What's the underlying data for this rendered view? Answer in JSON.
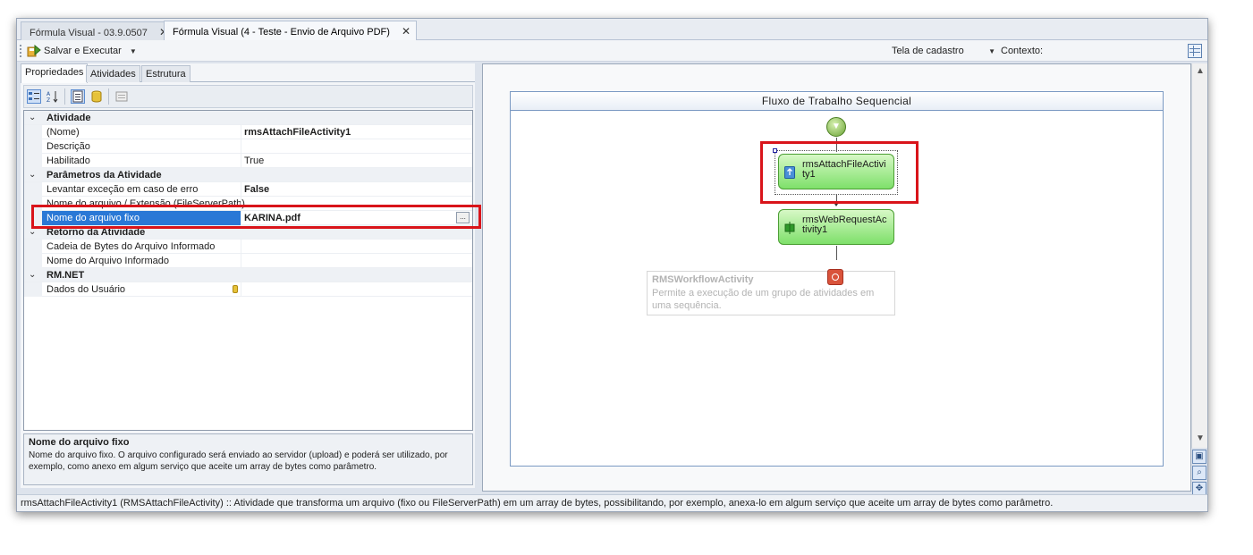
{
  "tabs": [
    {
      "label": "Fórmula Visual - 03.9.0507",
      "close": "✕"
    },
    {
      "label": "Fórmula Visual (4 - Teste - Envio de Arquivo PDF)",
      "close": "✕"
    }
  ],
  "toolbar": {
    "run_label": "Salvar e Executar",
    "screen_select": "Tela de cadastro",
    "context_label": "Contexto:"
  },
  "panel_tabs": [
    "Propriedades",
    "Atividades",
    "Estrutura"
  ],
  "properties": {
    "categories": [
      {
        "name": "Atividade"
      },
      {
        "name": "Parâmetros da Atividade"
      },
      {
        "name": "Retorno da Atividade"
      },
      {
        "name": "RM.NET"
      }
    ],
    "rows": [
      {
        "name": "(Nome)",
        "value": "rmsAttachFileActivity1"
      },
      {
        "name": "Descrição",
        "value": ""
      },
      {
        "name": "Habilitado",
        "value": "True"
      },
      {
        "name": "Levantar exceção em caso de erro",
        "value": "False"
      },
      {
        "name": "Nome do arquivo / Extensão (FileServerPath)",
        "value": ""
      },
      {
        "name": "Nome do arquivo fixo",
        "value": "KARINA.pdf",
        "button": "..."
      },
      {
        "name": "Cadeia de Bytes do Arquivo Informado",
        "value": ""
      },
      {
        "name": "Nome do Arquivo Informado",
        "value": ""
      },
      {
        "name": "Dados do Usuário",
        "value": ""
      }
    ]
  },
  "description": {
    "title": "Nome do arquivo fixo",
    "text": "Nome do arquivo fixo. O arquivo configurado será enviado ao servidor (upload) e poderá ser utilizado, por exemplo, como anexo em algum serviço que aceite um array de bytes como parâmetro."
  },
  "designer": {
    "title": "Fluxo de Trabalho Sequencial",
    "activities": [
      {
        "label": "rmsAttachFileActivi\nty1"
      },
      {
        "label": "rmsWebRequestAc\ntivity1"
      }
    ],
    "tooltip": {
      "title": "RMSWorkflowActivity",
      "text": "Permite a execução de um grupo de atividades em uma sequência."
    }
  },
  "statusbar": "rmsAttachFileActivity1  (RMSAttachFileActivity)  :: Atividade que transforma um arquivo (fixo ou FileServerPath) em um array de bytes, possibilitando, por exemplo, anexa-lo em algum serviço que aceite um array de bytes como parâmetro.",
  "colors": {
    "highlight": "#d9141a",
    "selection": "#2a78d6",
    "activity": "#7ee06a"
  }
}
